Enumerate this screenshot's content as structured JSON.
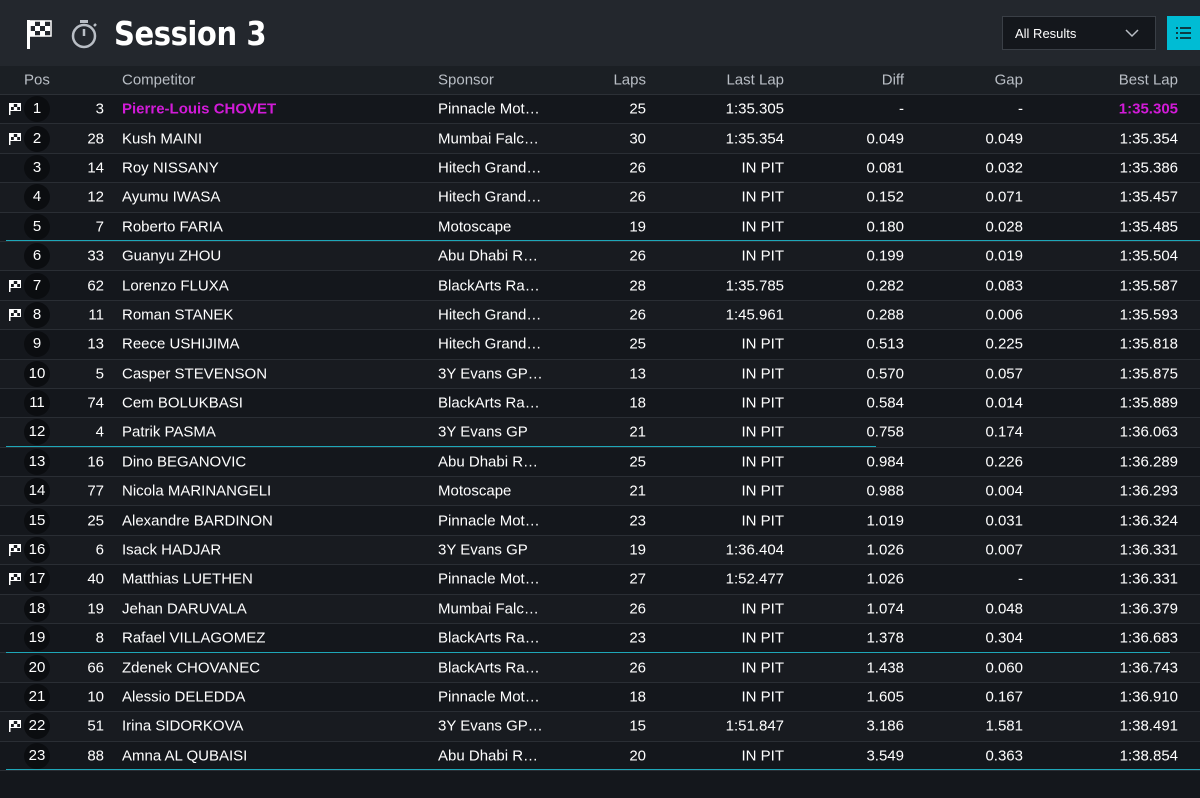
{
  "header": {
    "title": "Session 3",
    "filter_selected": "All Results"
  },
  "columns": {
    "pos": "Pos",
    "competitor": "Competitor",
    "sponsor": "Sponsor",
    "laps": "Laps",
    "last_lap": "Last Lap",
    "diff": "Diff",
    "gap": "Gap",
    "best_lap": "Best Lap"
  },
  "colors": {
    "accent": "#00bcd4",
    "fastest": "#d21bd8"
  },
  "rows": [
    {
      "pos": "1",
      "num": "3",
      "competitor": "Pierre-Louis CHOVET",
      "sponsor": "Pinnacle Mot…",
      "laps": "25",
      "last_lap": "1:35.305",
      "diff": "-",
      "gap": "-",
      "best_lap": "1:35.305",
      "flag": true,
      "fastest": true
    },
    {
      "pos": "2",
      "num": "28",
      "competitor": "Kush MAINI",
      "sponsor": "Mumbai Falc…",
      "laps": "30",
      "last_lap": "1:35.354",
      "diff": "0.049",
      "gap": "0.049",
      "best_lap": "1:35.354",
      "flag": true
    },
    {
      "pos": "3",
      "num": "14",
      "competitor": "Roy NISSANY",
      "sponsor": "Hitech Grand…",
      "laps": "26",
      "last_lap": "IN PIT",
      "diff": "0.081",
      "gap": "0.032",
      "best_lap": "1:35.386"
    },
    {
      "pos": "4",
      "num": "12",
      "competitor": "Ayumu IWASA",
      "sponsor": "Hitech Grand…",
      "laps": "26",
      "last_lap": "IN PIT",
      "diff": "0.152",
      "gap": "0.071",
      "best_lap": "1:35.457"
    },
    {
      "pos": "5",
      "num": "7",
      "competitor": "Roberto FARIA",
      "sponsor": "Motoscape",
      "laps": "19",
      "last_lap": "IN PIT",
      "diff": "0.180",
      "gap": "0.028",
      "best_lap": "1:35.485"
    },
    {
      "pos": "6",
      "num": "33",
      "competitor": "Guanyu ZHOU",
      "sponsor": "Abu Dhabi R…",
      "laps": "26",
      "last_lap": "IN PIT",
      "diff": "0.199",
      "gap": "0.019",
      "best_lap": "1:35.504"
    },
    {
      "pos": "7",
      "num": "62",
      "competitor": "Lorenzo FLUXA",
      "sponsor": "BlackArts Ra…",
      "laps": "28",
      "last_lap": "1:35.785",
      "diff": "0.282",
      "gap": "0.083",
      "best_lap": "1:35.587",
      "flag": true
    },
    {
      "pos": "8",
      "num": "11",
      "competitor": "Roman STANEK",
      "sponsor": "Hitech Grand…",
      "laps": "26",
      "last_lap": "1:45.961",
      "diff": "0.288",
      "gap": "0.006",
      "best_lap": "1:35.593",
      "flag": true
    },
    {
      "pos": "9",
      "num": "13",
      "competitor": "Reece USHIJIMA",
      "sponsor": "Hitech Grand…",
      "laps": "25",
      "last_lap": "IN PIT",
      "diff": "0.513",
      "gap": "0.225",
      "best_lap": "1:35.818"
    },
    {
      "pos": "10",
      "num": "5",
      "competitor": "Casper STEVENSON",
      "sponsor": "3Y Evans GP…",
      "laps": "13",
      "last_lap": "IN PIT",
      "diff": "0.570",
      "gap": "0.057",
      "best_lap": "1:35.875"
    },
    {
      "pos": "11",
      "num": "74",
      "competitor": "Cem BOLUKBASI",
      "sponsor": "BlackArts Ra…",
      "laps": "18",
      "last_lap": "IN PIT",
      "diff": "0.584",
      "gap": "0.014",
      "best_lap": "1:35.889"
    },
    {
      "pos": "12",
      "num": "4",
      "competitor": "Patrik PASMA",
      "sponsor": "3Y Evans GP",
      "laps": "21",
      "last_lap": "IN PIT",
      "diff": "0.758",
      "gap": "0.174",
      "best_lap": "1:36.063"
    },
    {
      "pos": "13",
      "num": "16",
      "competitor": "Dino BEGANOVIC",
      "sponsor": "Abu Dhabi R…",
      "laps": "25",
      "last_lap": "IN PIT",
      "diff": "0.984",
      "gap": "0.226",
      "best_lap": "1:36.289"
    },
    {
      "pos": "14",
      "num": "77",
      "competitor": "Nicola MARINANGELI",
      "sponsor": "Motoscape",
      "laps": "21",
      "last_lap": "IN PIT",
      "diff": "0.988",
      "gap": "0.004",
      "best_lap": "1:36.293"
    },
    {
      "pos": "15",
      "num": "25",
      "competitor": "Alexandre BARDINON",
      "sponsor": "Pinnacle Mot…",
      "laps": "23",
      "last_lap": "IN PIT",
      "diff": "1.019",
      "gap": "0.031",
      "best_lap": "1:36.324"
    },
    {
      "pos": "16",
      "num": "6",
      "competitor": "Isack HADJAR",
      "sponsor": "3Y Evans GP",
      "laps": "19",
      "last_lap": "1:36.404",
      "diff": "1.026",
      "gap": "0.007",
      "best_lap": "1:36.331",
      "flag": true
    },
    {
      "pos": "17",
      "num": "40",
      "competitor": "Matthias LUETHEN",
      "sponsor": "Pinnacle Mot…",
      "laps": "27",
      "last_lap": "1:52.477",
      "diff": "1.026",
      "gap": "-",
      "best_lap": "1:36.331",
      "flag": true
    },
    {
      "pos": "18",
      "num": "19",
      "competitor": "Jehan DARUVALA",
      "sponsor": "Mumbai Falc…",
      "laps": "26",
      "last_lap": "IN PIT",
      "diff": "1.074",
      "gap": "0.048",
      "best_lap": "1:36.379"
    },
    {
      "pos": "19",
      "num": "8",
      "competitor": "Rafael VILLAGOMEZ",
      "sponsor": "BlackArts Ra…",
      "laps": "23",
      "last_lap": "IN PIT",
      "diff": "1.378",
      "gap": "0.304",
      "best_lap": "1:36.683"
    },
    {
      "pos": "20",
      "num": "66",
      "competitor": "Zdenek CHOVANEC",
      "sponsor": "BlackArts Ra…",
      "laps": "26",
      "last_lap": "IN PIT",
      "diff": "1.438",
      "gap": "0.060",
      "best_lap": "1:36.743"
    },
    {
      "pos": "21",
      "num": "10",
      "competitor": "Alessio DELEDDA",
      "sponsor": "Pinnacle Mot…",
      "laps": "18",
      "last_lap": "IN PIT",
      "diff": "1.605",
      "gap": "0.167",
      "best_lap": "1:36.910"
    },
    {
      "pos": "22",
      "num": "51",
      "competitor": "Irina SIDORKOVA",
      "sponsor": "3Y Evans GP…",
      "laps": "15",
      "last_lap": "1:51.847",
      "diff": "3.186",
      "gap": "1.581",
      "best_lap": "1:38.491",
      "flag": true
    },
    {
      "pos": "23",
      "num": "88",
      "competitor": "Amna AL QUBAISI",
      "sponsor": "Abu Dhabi R…",
      "laps": "20",
      "last_lap": "IN PIT",
      "diff": "3.549",
      "gap": "0.363",
      "best_lap": "1:38.854"
    }
  ]
}
